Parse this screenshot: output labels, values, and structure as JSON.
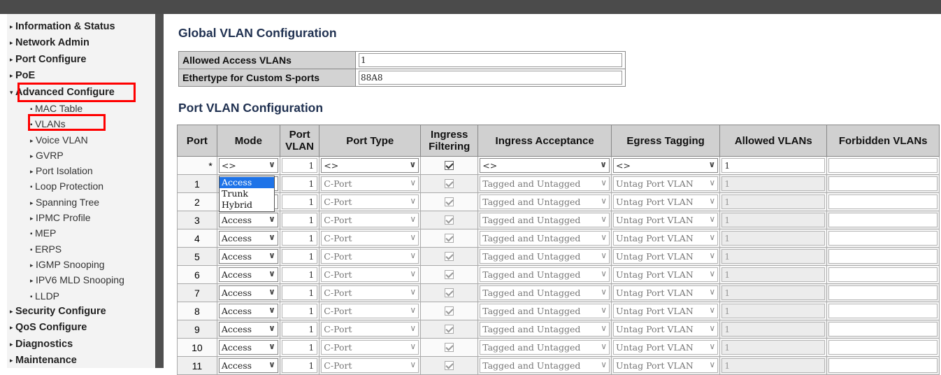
{
  "sidebar": {
    "items": [
      {
        "label": "Information & Status",
        "level": "top"
      },
      {
        "label": "Network Admin",
        "level": "top"
      },
      {
        "label": "Port Configure",
        "level": "top"
      },
      {
        "label": "PoE",
        "level": "top"
      },
      {
        "label": "Advanced Configure",
        "level": "top",
        "expanded": true,
        "highlighted": true
      },
      {
        "label": "MAC Table",
        "level": "sub",
        "marker": "bullet"
      },
      {
        "label": "VLANs",
        "level": "sub",
        "marker": "bullet",
        "highlighted": true
      },
      {
        "label": "Voice VLAN",
        "level": "sub",
        "marker": "arrow"
      },
      {
        "label": "GVRP",
        "level": "sub",
        "marker": "arrow"
      },
      {
        "label": "Port Isolation",
        "level": "sub",
        "marker": "arrow"
      },
      {
        "label": "Loop Protection",
        "level": "sub",
        "marker": "bullet"
      },
      {
        "label": "Spanning Tree",
        "level": "sub",
        "marker": "arrow"
      },
      {
        "label": "IPMC Profile",
        "level": "sub",
        "marker": "arrow"
      },
      {
        "label": "MEP",
        "level": "sub",
        "marker": "bullet"
      },
      {
        "label": "ERPS",
        "level": "sub",
        "marker": "bullet"
      },
      {
        "label": "IGMP Snooping",
        "level": "sub",
        "marker": "arrow"
      },
      {
        "label": "IPV6 MLD Snooping",
        "level": "sub",
        "marker": "arrow"
      },
      {
        "label": "LLDP",
        "level": "sub",
        "marker": "bullet"
      },
      {
        "label": "Security Configure",
        "level": "top"
      },
      {
        "label": "QoS Configure",
        "level": "top"
      },
      {
        "label": "Diagnostics",
        "level": "top"
      },
      {
        "label": "Maintenance",
        "level": "top"
      }
    ],
    "highlight_color": "#ff0000"
  },
  "global": {
    "title": "Global VLAN Configuration",
    "rows": [
      {
        "label": "Allowed Access VLANs",
        "value": "1"
      },
      {
        "label": "Ethertype for Custom S-ports",
        "value": "88A8"
      }
    ]
  },
  "port": {
    "title": "Port VLAN Configuration",
    "headers": [
      "Port",
      "Mode",
      "Port VLAN",
      "Port Type",
      "Ingress Filtering",
      "Ingress Acceptance",
      "Egress Tagging",
      "Allowed VLANs",
      "Forbidden VLANs"
    ],
    "wildcard": {
      "port": "*",
      "mode": "<>",
      "port_vlan": "1",
      "port_type": "<>",
      "ingress_filtering": true,
      "ingress_acceptance": "<>",
      "egress_tagging": "<>",
      "allowed_vlans": "1",
      "forbidden_vlans": ""
    },
    "rows": [
      {
        "port": "1",
        "mode": "Access",
        "port_vlan": "1",
        "port_type": "C-Port",
        "ingress_filtering": true,
        "ingress_acceptance": "Tagged and Untagged",
        "egress_tagging": "Untag Port VLAN",
        "allowed_vlans": "1",
        "forbidden_vlans": ""
      },
      {
        "port": "2",
        "mode": "Access",
        "port_vlan": "1",
        "port_type": "C-Port",
        "ingress_filtering": true,
        "ingress_acceptance": "Tagged and Untagged",
        "egress_tagging": "Untag Port VLAN",
        "allowed_vlans": "1",
        "forbidden_vlans": ""
      },
      {
        "port": "3",
        "mode": "Access",
        "port_vlan": "1",
        "port_type": "C-Port",
        "ingress_filtering": true,
        "ingress_acceptance": "Tagged and Untagged",
        "egress_tagging": "Untag Port VLAN",
        "allowed_vlans": "1",
        "forbidden_vlans": ""
      },
      {
        "port": "4",
        "mode": "Access",
        "port_vlan": "1",
        "port_type": "C-Port",
        "ingress_filtering": true,
        "ingress_acceptance": "Tagged and Untagged",
        "egress_tagging": "Untag Port VLAN",
        "allowed_vlans": "1",
        "forbidden_vlans": ""
      },
      {
        "port": "5",
        "mode": "Access",
        "port_vlan": "1",
        "port_type": "C-Port",
        "ingress_filtering": true,
        "ingress_acceptance": "Tagged and Untagged",
        "egress_tagging": "Untag Port VLAN",
        "allowed_vlans": "1",
        "forbidden_vlans": ""
      },
      {
        "port": "6",
        "mode": "Access",
        "port_vlan": "1",
        "port_type": "C-Port",
        "ingress_filtering": true,
        "ingress_acceptance": "Tagged and Untagged",
        "egress_tagging": "Untag Port VLAN",
        "allowed_vlans": "1",
        "forbidden_vlans": ""
      },
      {
        "port": "7",
        "mode": "Access",
        "port_vlan": "1",
        "port_type": "C-Port",
        "ingress_filtering": true,
        "ingress_acceptance": "Tagged and Untagged",
        "egress_tagging": "Untag Port VLAN",
        "allowed_vlans": "1",
        "forbidden_vlans": ""
      },
      {
        "port": "8",
        "mode": "Access",
        "port_vlan": "1",
        "port_type": "C-Port",
        "ingress_filtering": true,
        "ingress_acceptance": "Tagged and Untagged",
        "egress_tagging": "Untag Port VLAN",
        "allowed_vlans": "1",
        "forbidden_vlans": ""
      },
      {
        "port": "9",
        "mode": "Access",
        "port_vlan": "1",
        "port_type": "C-Port",
        "ingress_filtering": true,
        "ingress_acceptance": "Tagged and Untagged",
        "egress_tagging": "Untag Port VLAN",
        "allowed_vlans": "1",
        "forbidden_vlans": ""
      },
      {
        "port": "10",
        "mode": "Access",
        "port_vlan": "1",
        "port_type": "C-Port",
        "ingress_filtering": true,
        "ingress_acceptance": "Tagged and Untagged",
        "egress_tagging": "Untag Port VLAN",
        "allowed_vlans": "1",
        "forbidden_vlans": ""
      },
      {
        "port": "11",
        "mode": "Access",
        "port_vlan": "1",
        "port_type": "C-Port",
        "ingress_filtering": true,
        "ingress_acceptance": "Tagged and Untagged",
        "egress_tagging": "Untag Port VLAN",
        "allowed_vlans": "1",
        "forbidden_vlans": ""
      }
    ],
    "mode_dropdown": {
      "options": [
        "Access",
        "Trunk",
        "Hybrid"
      ],
      "selected": "Access",
      "open_on_port": "1"
    }
  },
  "colors": {
    "dropdown_selected": "#1e73e8",
    "header_bg": "#d0d0d0",
    "title_color": "#1f3050"
  }
}
